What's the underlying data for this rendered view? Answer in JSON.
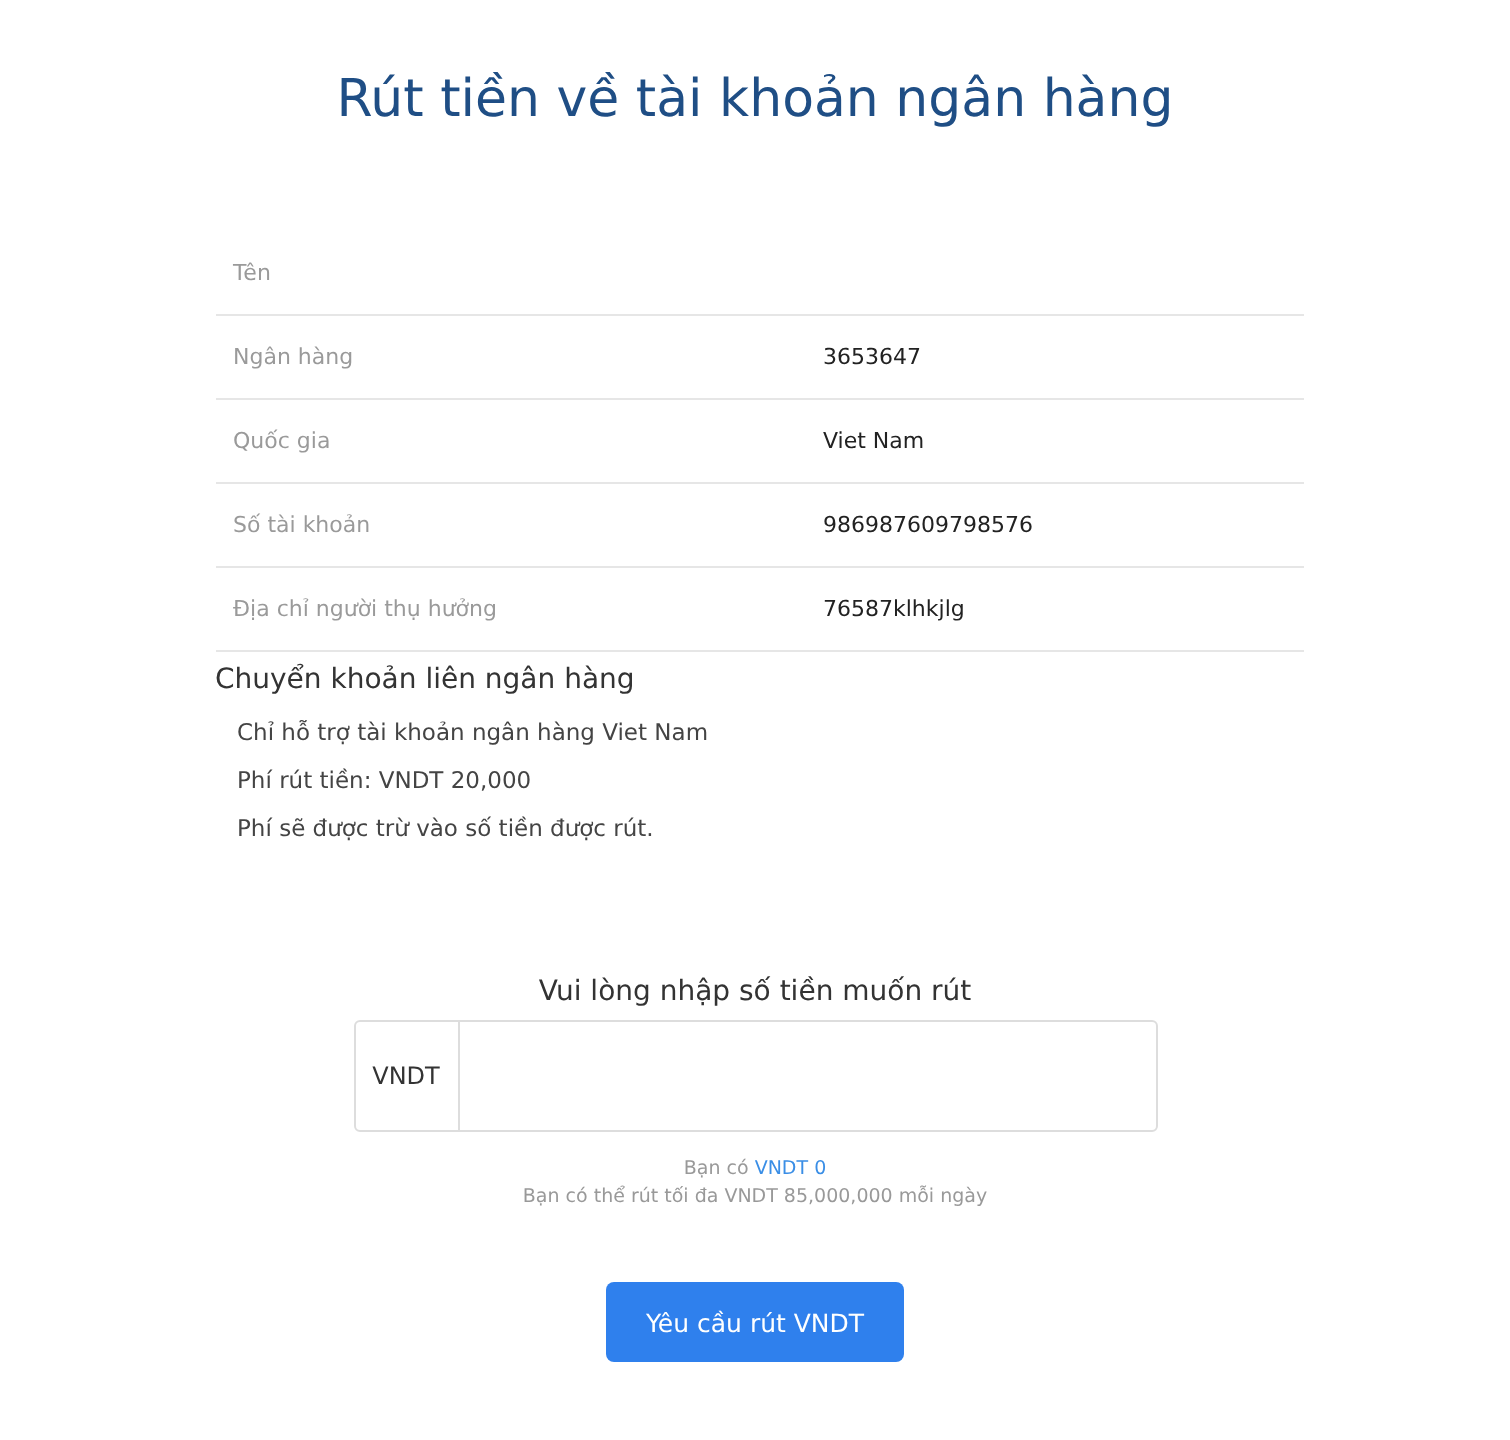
{
  "title": "Rút tiền về tài khoản ngân hàng",
  "details": [
    {
      "label": "Tên"
    },
    {
      "label": "Ngân hàng",
      "value": "3653647"
    },
    {
      "label": "Quốc gia",
      "value": "Viet Nam"
    },
    {
      "label": "Số tài khoản",
      "value": "986987609798576"
    },
    {
      "label": "Địa chỉ người thụ hưởng",
      "value": "76587klhkjlg"
    }
  ],
  "transfer": {
    "heading": "Chuyển khoản liên ngân hàng",
    "notes": [
      "Chỉ hỗ trợ tài khoản ngân hàng Viet Nam",
      "Phí rút tiền: VNDT 20,000",
      "Phí sẽ được trừ vào số tiền được rút."
    ]
  },
  "amount": {
    "prompt": "Vui lòng nhập số tiền muốn rút",
    "currency": "VNDT",
    "balance_prefix": "Bạn có",
    "balance_link": "VNDT 0",
    "limit": "Bạn có thể rút tối đa VNDT 85,000,000 mỗi ngày"
  },
  "submit": "Yêu cầu rút VNDT"
}
